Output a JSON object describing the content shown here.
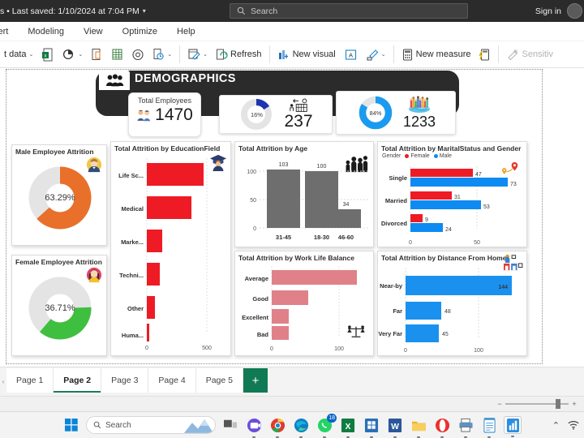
{
  "titlebar": {
    "document_status": "s • Last saved: 1/10/2024 at 7:04 PM",
    "caret": "▾",
    "search_placeholder": "Search",
    "search_icon": "search-icon",
    "signin_label": "Sign in"
  },
  "menubar": {
    "items": [
      {
        "label": "sert"
      },
      {
        "label": "Modeling"
      },
      {
        "label": "View"
      },
      {
        "label": "Optimize"
      },
      {
        "label": "Help"
      }
    ]
  },
  "ribbon": {
    "get_data_label": "t data",
    "refresh_label": "Refresh",
    "new_visual_label": "New visual",
    "new_measure_label": "New measure",
    "sensitivity_label": "Sensitiv",
    "chevron": "⌄"
  },
  "report": {
    "header": {
      "title": "DEMOGRAPHICS",
      "icon": "people-group-icon"
    },
    "kpis": [
      {
        "name": "total-employees",
        "label": "Total Employees",
        "value": "1470",
        "icon": "employees-icon"
      },
      {
        "name": "attrition-count",
        "percent": "16%",
        "percent_value": 16,
        "value": "237",
        "icon": "employee-exit-icon",
        "color": "#1c34b0"
      },
      {
        "name": "active-count",
        "percent": "84%",
        "percent_value": 84,
        "value": "1233",
        "icon": "diverse-people-globe-icon",
        "color": "#1a9bf0"
      }
    ]
  },
  "chart_data": [
    {
      "type": "pie",
      "name": "male-employee-attrition",
      "title": "Male Employee Attrition",
      "center_label": "63.29%",
      "value": 63.29,
      "color": "#e8702a",
      "track_color": "#e3e3e3",
      "icon": "male-avatar-icon"
    },
    {
      "type": "pie",
      "name": "female-employee-attrition",
      "title": "Female Employee Attrition",
      "center_label": "36.71%",
      "value": 36.71,
      "color": "#3fbf3f",
      "track_color": "#e3e3e3",
      "icon": "female-avatar-icon"
    },
    {
      "type": "bar",
      "orientation": "horizontal",
      "name": "attrition-by-educationfield",
      "title": "Total Attrition by EducationField",
      "categories": [
        "Life Sc...",
        "Medical",
        "Marke...",
        "Techni...",
        "Other",
        "Huma..."
      ],
      "values": [
        590,
        460,
        160,
        132,
        82,
        20
      ],
      "xlim": [
        0,
        620
      ],
      "xticks": [
        "0",
        "500"
      ],
      "xtick_values": [
        0,
        500
      ],
      "color": "#ee1b24",
      "icon": "graduate-icon",
      "grid": true
    },
    {
      "type": "bar",
      "orientation": "vertical",
      "name": "attrition-by-age",
      "title": "Total Attrition by Age",
      "categories": [
        "31-45",
        "18-30",
        "46-60"
      ],
      "values": [
        103,
        100,
        34
      ],
      "data_labels": [
        "103",
        "100",
        "34"
      ],
      "ylim": [
        0,
        115
      ],
      "yticks": [
        "0",
        "50",
        "100"
      ],
      "ytick_values": [
        0,
        50,
        100
      ],
      "color": "#6e6e6e",
      "icon": "family-people-icon",
      "grid": true
    },
    {
      "type": "bar",
      "orientation": "horizontal",
      "name": "attrition-by-maritalstatus-and-gender",
      "title": "Total Attrition by MaritalStatus and Gender",
      "legend_title": "Gender",
      "legend_position": "top",
      "categories": [
        "Single",
        "Married",
        "Divorced"
      ],
      "series": [
        {
          "name": "Female",
          "color": "#ee1b24",
          "values": [
            47,
            31,
            9
          ]
        },
        {
          "name": "Male",
          "color": "#0d8bf2",
          "values": [
            73,
            53,
            24
          ]
        }
      ],
      "xlim": [
        0,
        82
      ],
      "xticks": [
        "0",
        "50"
      ],
      "xtick_values": [
        0,
        50
      ],
      "icon": "location-pins-icon",
      "grid": true
    },
    {
      "type": "bar",
      "orientation": "horizontal",
      "name": "attrition-by-work-life-balance",
      "title": "Total Attrition by Work Life Balance",
      "categories": [
        "Average",
        "Good",
        "Excellent",
        "Bad"
      ],
      "values": [
        127,
        55,
        25,
        25
      ],
      "xlim": [
        0,
        140
      ],
      "xticks": [
        "0",
        "100"
      ],
      "xtick_values": [
        0,
        100
      ],
      "color": "#e08189",
      "icon": "work-life-balance-scale-icon",
      "grid": true
    },
    {
      "type": "bar",
      "orientation": "horizontal",
      "name": "attrition-by-distance-from-home",
      "title": "Total Attrition by Distance From Home",
      "categories": [
        "Near-by",
        "Far",
        "Very Far"
      ],
      "values": [
        144,
        48,
        45
      ],
      "data_labels": [
        "144",
        "48",
        "45"
      ],
      "xlim": [
        0,
        160
      ],
      "xticks": [
        "0",
        "100"
      ],
      "xtick_values": [
        0,
        100
      ],
      "color": "#1b91ef",
      "icon": "home-distance-icon",
      "grid": true
    }
  ],
  "pagebar": {
    "tabs": [
      {
        "label": "Page 1",
        "active": false
      },
      {
        "label": "Page 2",
        "active": true
      },
      {
        "label": "Page 3",
        "active": false
      },
      {
        "label": "Page 4",
        "active": false
      },
      {
        "label": "Page 5",
        "active": false
      }
    ],
    "add_label": "+"
  },
  "statusbar": {
    "zoom_minus": "−",
    "zoom_plus": "+"
  },
  "taskbar": {
    "search_placeholder": "Search",
    "items": [
      {
        "name": "start-button",
        "icon": "windows-logo-icon"
      },
      {
        "name": "taskview-button",
        "icon": "task-view-icon"
      },
      {
        "name": "teams-app",
        "icon": "teams-icon"
      },
      {
        "name": "chrome-app",
        "icon": "chrome-icon"
      },
      {
        "name": "edge-app",
        "icon": "edge-icon"
      },
      {
        "name": "whatsapp-app",
        "icon": "whatsapp-icon",
        "badge": "18"
      },
      {
        "name": "excel-app",
        "icon": "excel-icon"
      },
      {
        "name": "store-app",
        "icon": "microsoft-store-icon"
      },
      {
        "name": "word-app",
        "icon": "word-icon"
      },
      {
        "name": "explorer-app",
        "icon": "file-explorer-icon"
      },
      {
        "name": "opera-app",
        "icon": "opera-icon"
      },
      {
        "name": "printer-app",
        "icon": "printer-icon"
      },
      {
        "name": "notepad-app",
        "icon": "notepad-icon"
      },
      {
        "name": "powerbi-app",
        "icon": "power-bi-icon"
      }
    ],
    "tray": {
      "chevron": "⌃",
      "wifi": "wifi-icon"
    }
  }
}
